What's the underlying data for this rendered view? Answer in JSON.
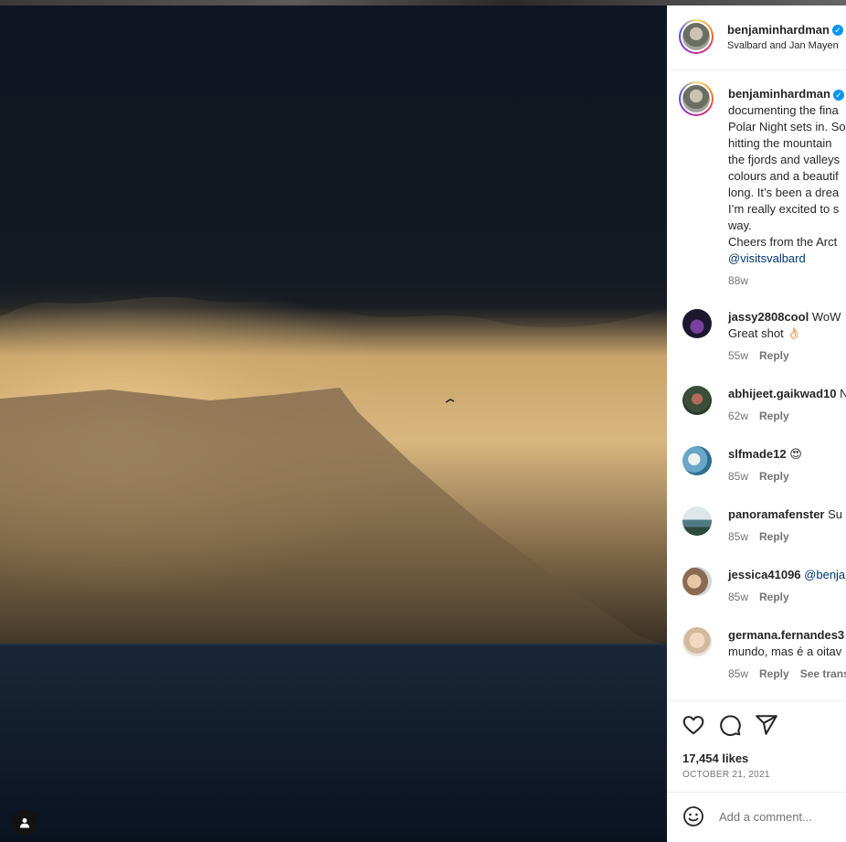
{
  "post": {
    "username": "benjaminhardman",
    "location": "Svalbard and Jan Mayen"
  },
  "caption": {
    "username": "benjaminhardman",
    "lines": [
      "documenting the fina",
      "Polar Night sets in. So",
      "hitting the mountain",
      "the fjords and valleys",
      "colours and a beautif",
      "long. It’s been a drea",
      "I’m really excited to s",
      "way.",
      "Cheers from the Arct"
    ],
    "mention": "@visitsvalbard",
    "age": "88w"
  },
  "comments": [
    {
      "username": "jassy2808cool",
      "text": "WoW",
      "text2": "Great shot 👌🏻",
      "age": "55w",
      "reply": "Reply",
      "extra": ""
    },
    {
      "username": "abhijeet.gaikwad10",
      "text": "N",
      "text2": "",
      "age": "62w",
      "reply": "Reply",
      "extra": ""
    },
    {
      "username": "slfmade12",
      "text": "😍",
      "text2": "",
      "age": "85w",
      "reply": "Reply",
      "extra": ""
    },
    {
      "username": "panoramafenster",
      "text": "Su",
      "text2": "",
      "age": "85w",
      "reply": "Reply",
      "extra": ""
    },
    {
      "username": "jessica41096",
      "text": "@benja",
      "text2": "",
      "age": "85w",
      "reply": "Reply",
      "extra": ""
    },
    {
      "username": "germana.fernandes3",
      "text": "",
      "text2": "mundo, mas é a oitav",
      "age": "85w",
      "reply": "Reply",
      "extra": "See transl"
    }
  ],
  "stats": {
    "likes": "17,454 likes",
    "date": "OCTOBER 21, 2021"
  },
  "add_comment": {
    "placeholder": "Add a comment..."
  },
  "colors": {
    "verified": "#0095f6",
    "mention": "#00376b",
    "muted": "#737373"
  },
  "icons": [
    "user-tag-icon",
    "heart-icon",
    "comment-icon",
    "share-icon",
    "emoji-icon",
    "verified-icon"
  ]
}
